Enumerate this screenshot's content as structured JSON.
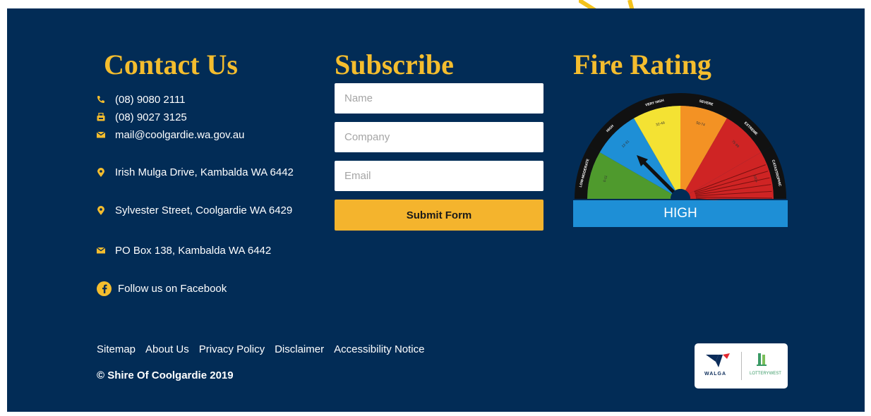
{
  "contact": {
    "heading": "Contact Us",
    "phone": "(08) 9080 2111",
    "fax": "(08) 9027 3125",
    "email": "mail@coolgardie.wa.gov.au",
    "address1": "Irish Mulga Drive, Kambalda WA 6442",
    "address2": "Sylvester Street, Coolgardie WA 6429",
    "po_box": "PO Box 138, Kambalda WA 6442",
    "facebook": "Follow us on Facebook"
  },
  "subscribe": {
    "heading": "Subscribe",
    "name_placeholder": "Name",
    "company_placeholder": "Company",
    "email_placeholder": "Email",
    "submit_label": "Submit Form"
  },
  "fire_rating": {
    "heading": "Fire Rating",
    "current": "HIGH",
    "segments": [
      {
        "label": "LOW-MODERATE",
        "range": "0-11",
        "color": "#4f9a2d"
      },
      {
        "label": "HIGH",
        "range": "12-31",
        "color": "#1e8fd6"
      },
      {
        "label": "VERY HIGH",
        "range": "32-49",
        "color": "#f4e233"
      },
      {
        "label": "SEVERE",
        "range": "50-74",
        "color": "#f39224"
      },
      {
        "label": "EXTREME",
        "range": "75-99",
        "color": "#cf2424"
      },
      {
        "label": "CATASTROPHIC",
        "range": "100+",
        "color": "#cf2424"
      }
    ]
  },
  "footer": {
    "links": [
      "Sitemap",
      "About Us",
      "Privacy Policy",
      "Disclaimer",
      "Accessibility Notice"
    ],
    "copyright": "© Shire Of Coolgardie 2019",
    "logos": {
      "walga": "WALGA",
      "lotterywest": "LOTTERYWEST"
    }
  },
  "colors": {
    "background": "#022c56",
    "accent": "#f4bd2e",
    "button": "#f4b42d",
    "rating_high": "#1e8fd6"
  }
}
